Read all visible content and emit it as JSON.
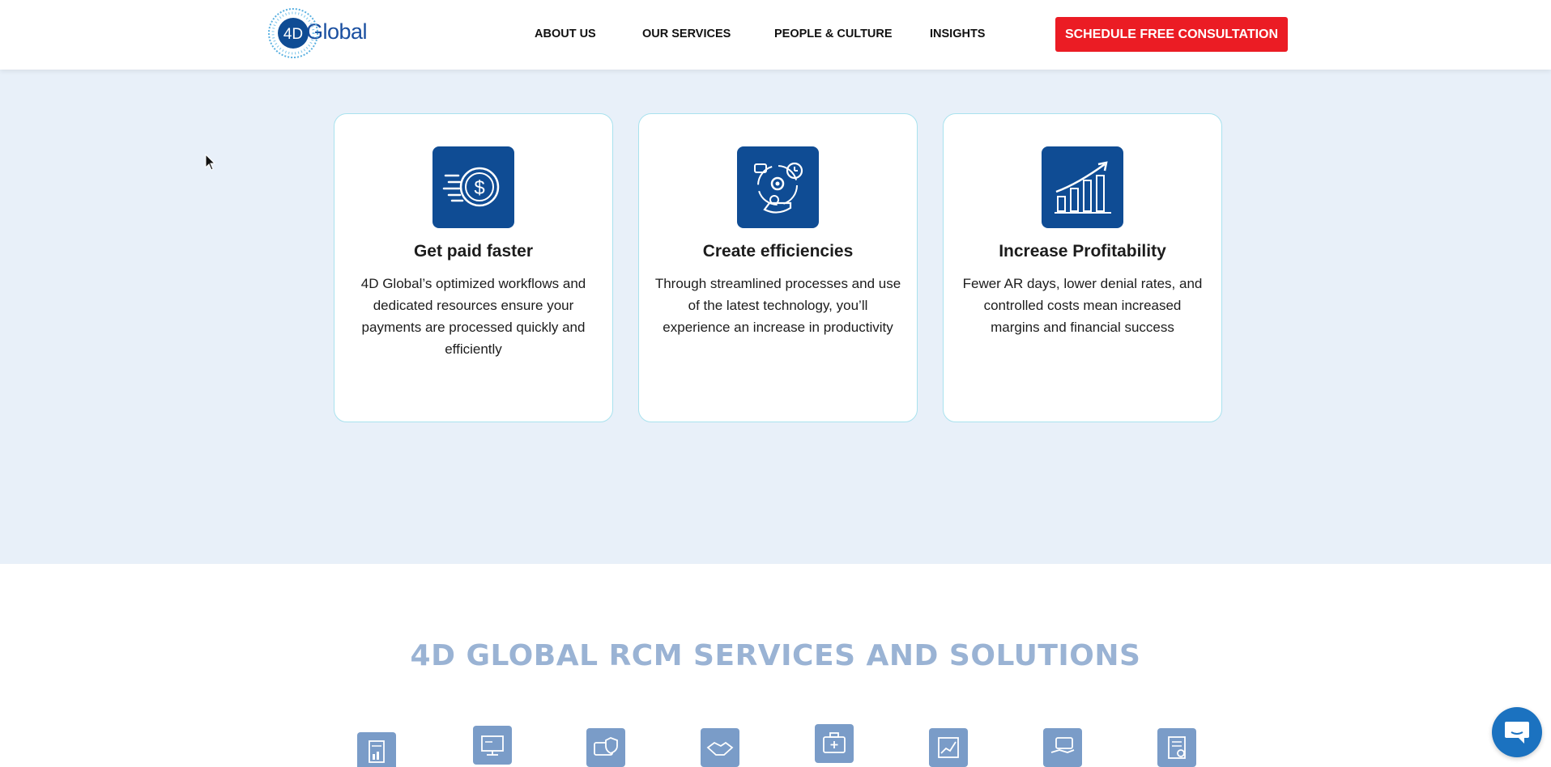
{
  "header": {
    "logo_text": "Global",
    "logo_mark": "4D",
    "nav": [
      {
        "label": "ABOUT US"
      },
      {
        "label": "OUR SERVICES"
      },
      {
        "label": "PEOPLE & CULTURE"
      },
      {
        "label": "INSIGHTS"
      }
    ],
    "cta_label": "SCHEDULE FREE CONSULTATION",
    "cta_color": "#eb1c24"
  },
  "benefits": [
    {
      "icon": "dollar-coin-speed-icon",
      "title": "Get paid faster",
      "body": "4D Global’s optimized workflows and dedicated resources ensure your payments are processed quickly and efficiently"
    },
    {
      "icon": "efficiency-gears-clock-icon",
      "title": "Create efficiencies",
      "body": "Through streamlined processes and use of the latest technology, you’ll experience an increase in productivity"
    },
    {
      "icon": "growth-chart-icon",
      "title": "Increase Profitability",
      "body": "Fewer AR days, lower denial rates, and controlled costs mean increased margins and financial success"
    }
  ],
  "services_section": {
    "title": "4D GLOBAL RCM SERVICES AND SOLUTIONS",
    "icons": [
      "document-chart-icon",
      "monitor-analytics-icon",
      "card-shield-icon",
      "handshake-icon",
      "briefcase-medical-icon",
      "report-chart-icon",
      "hand-card-icon",
      "certificate-icon"
    ]
  },
  "colors": {
    "brand_blue": "#0f4c94",
    "band_bg": "#e8f0f9",
    "section_title": "#9ab3d4",
    "chat_button": "#1b72c0"
  }
}
